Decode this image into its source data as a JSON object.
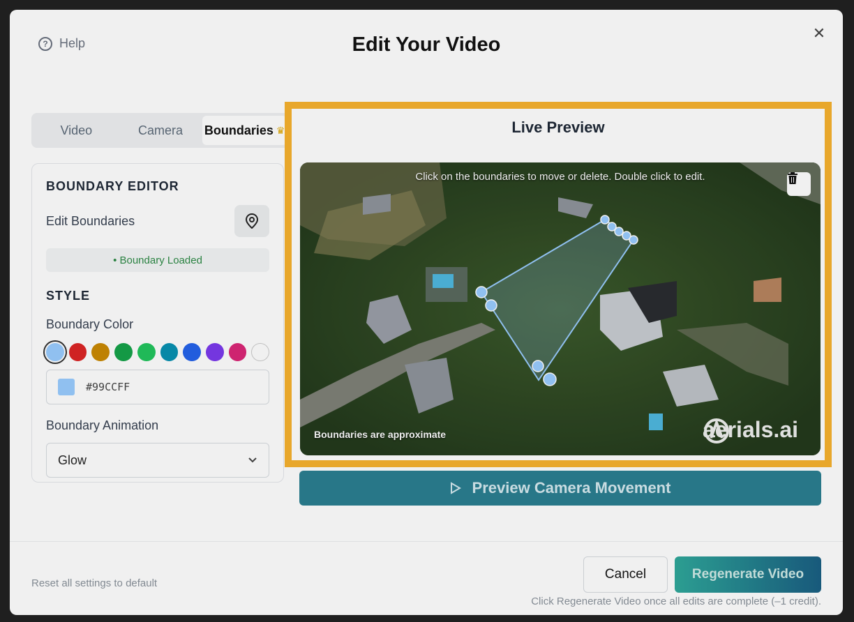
{
  "header": {
    "title": "Edit Your Video",
    "help_label": "Help"
  },
  "tabs": [
    {
      "label": "Video"
    },
    {
      "label": "Camera"
    },
    {
      "label": "Boundaries",
      "active": true,
      "premium_icon": "crown-icon"
    }
  ],
  "boundary_editor": {
    "heading": "BOUNDARY EDITOR",
    "edit_label": "Edit Boundaries",
    "status": "• Boundary Loaded"
  },
  "style": {
    "heading": "STYLE",
    "color_label": "Boundary Color",
    "swatches": [
      "#99CCFF",
      "#dc2626",
      "#ca8a04",
      "#16a34a",
      "#22c55e",
      "#0891b2",
      "#2563eb",
      "#7c3aed",
      "#db2777",
      "#ffffff"
    ],
    "selected_swatch_index": 0,
    "hex_value": "#99CCFF",
    "animation_label": "Boundary Animation",
    "animation_value": "Glow"
  },
  "preview": {
    "title": "Live Preview",
    "instruction": "Click on the boundaries to move or delete. Double click to edit.",
    "disclaimer": "Boundaries are approximate",
    "brand": "aerials.ai",
    "button_label": "Preview Camera Movement",
    "boundary_color": "#99CCFF"
  },
  "footer": {
    "reset_label": "Reset all settings to default",
    "cancel_label": "Cancel",
    "regenerate_label": "Regenerate Video",
    "note": "Click Regenerate Video once all edits are complete (–1 credit)."
  }
}
